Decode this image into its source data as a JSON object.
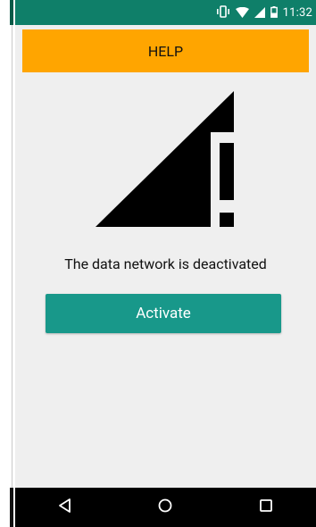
{
  "status_bar": {
    "time": "11:32",
    "icons": [
      "vibrate-icon",
      "wifi-icon",
      "signal-icon",
      "battery-icon"
    ],
    "background_color": "#0f7f69"
  },
  "header": {
    "title": "HELP",
    "background_color": "#ffa500"
  },
  "main": {
    "illustration_icon": "no-data-signal-icon",
    "message": "The data network is deactivated",
    "activate_label": "Activate",
    "button_color": "#18988a"
  },
  "nav_bar": {
    "items": [
      "back-icon",
      "home-icon",
      "recents-icon"
    ]
  }
}
